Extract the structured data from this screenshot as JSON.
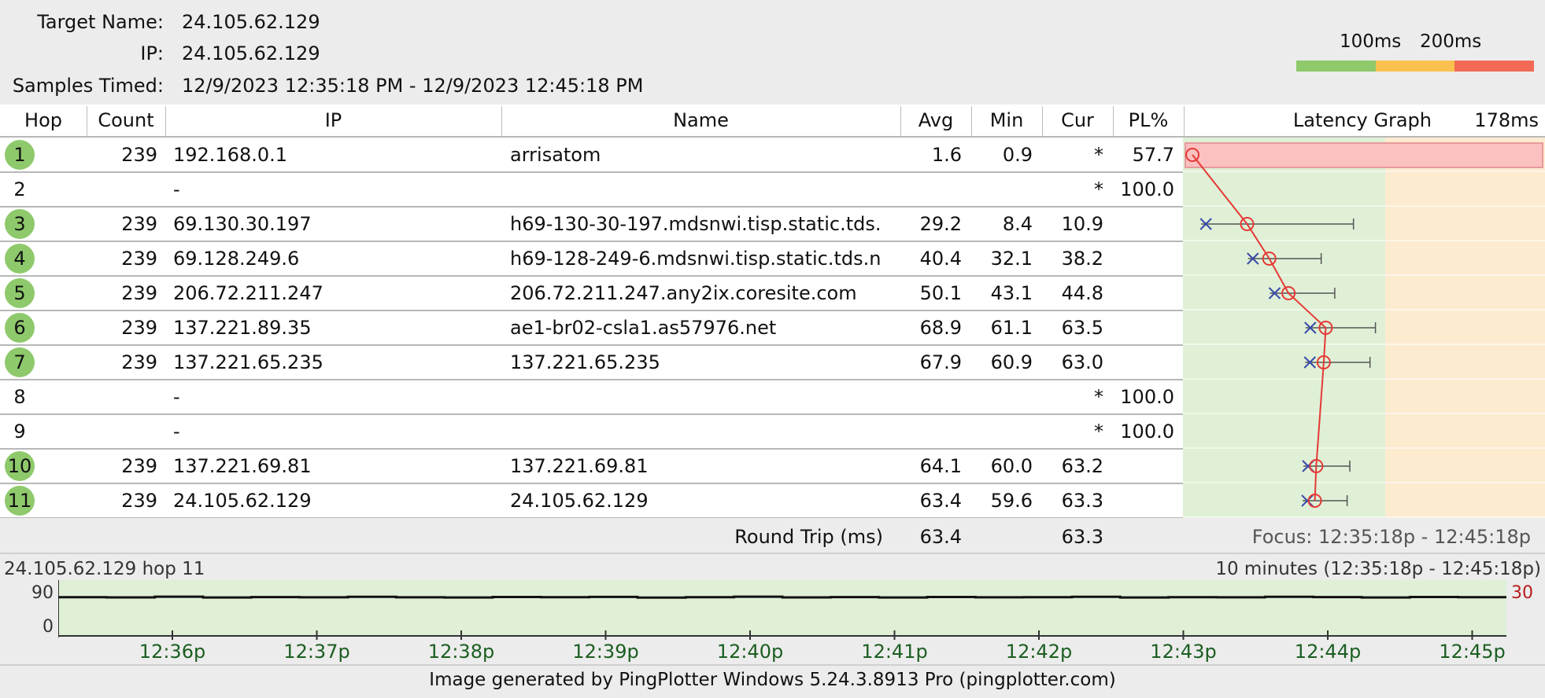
{
  "header": {
    "target_name_label": "Target Name:",
    "target_name": "24.105.62.129",
    "ip_label": "IP:",
    "ip": "24.105.62.129",
    "samples_label": "Samples Timed:",
    "samples_value": "12/9/2023 12:35:18 PM - 12/9/2023 12:45:18 PM"
  },
  "legend": {
    "label_100": "100ms",
    "label_200": "200ms",
    "colors": [
      "#8ec96b",
      "#f9c24f",
      "#f26a55"
    ]
  },
  "table": {
    "columns": {
      "hop": "Hop",
      "count": "Count",
      "ip": "IP",
      "name": "Name",
      "avg": "Avg",
      "min": "Min",
      "cur": "Cur",
      "pl": "PL%",
      "graph": "Latency Graph",
      "graph_max": "178ms"
    },
    "rows": [
      {
        "hop": "1",
        "ok": true,
        "count": "239",
        "ip": "192.168.0.1",
        "name": "arrisatom",
        "avg": "1.6",
        "min": "0.9",
        "cur": "*",
        "pl": "57.7"
      },
      {
        "hop": "2",
        "ok": false,
        "count": "",
        "ip": "-",
        "name": "",
        "avg": "",
        "min": "",
        "cur": "*",
        "pl": "100.0"
      },
      {
        "hop": "3",
        "ok": true,
        "count": "239",
        "ip": "69.130.30.197",
        "name": "h69-130-30-197.mdsnwi.tisp.static.tds.",
        "avg": "29.2",
        "min": "8.4",
        "cur": "10.9",
        "pl": ""
      },
      {
        "hop": "4",
        "ok": true,
        "count": "239",
        "ip": "69.128.249.6",
        "name": "h69-128-249-6.mdsnwi.tisp.static.tds.n",
        "avg": "40.4",
        "min": "32.1",
        "cur": "38.2",
        "pl": ""
      },
      {
        "hop": "5",
        "ok": true,
        "count": "239",
        "ip": "206.72.211.247",
        "name": "206.72.211.247.any2ix.coresite.com",
        "avg": "50.1",
        "min": "43.1",
        "cur": "44.8",
        "pl": ""
      },
      {
        "hop": "6",
        "ok": true,
        "count": "239",
        "ip": "137.221.89.35",
        "name": "ae1-br02-csla1.as57976.net",
        "avg": "68.9",
        "min": "61.1",
        "cur": "63.5",
        "pl": ""
      },
      {
        "hop": "7",
        "ok": true,
        "count": "239",
        "ip": "137.221.65.235",
        "name": "137.221.65.235",
        "avg": "67.9",
        "min": "60.9",
        "cur": "63.0",
        "pl": ""
      },
      {
        "hop": "8",
        "ok": false,
        "count": "",
        "ip": "-",
        "name": "",
        "avg": "",
        "min": "",
        "cur": "*",
        "pl": "100.0"
      },
      {
        "hop": "9",
        "ok": false,
        "count": "",
        "ip": "-",
        "name": "",
        "avg": "",
        "min": "",
        "cur": "*",
        "pl": "100.0"
      },
      {
        "hop": "10",
        "ok": true,
        "count": "239",
        "ip": "137.221.69.81",
        "name": "137.221.69.81",
        "avg": "64.1",
        "min": "60.0",
        "cur": "63.2",
        "pl": ""
      },
      {
        "hop": "11",
        "ok": true,
        "count": "239",
        "ip": "24.105.62.129",
        "name": "24.105.62.129",
        "avg": "63.4",
        "min": "59.6",
        "cur": "63.3",
        "pl": ""
      }
    ],
    "round_trip_label": "Round Trip (ms)",
    "round_trip_avg": "63.4",
    "round_trip_cur": "63.3",
    "focus_text": "Focus: 12:35:18p - 12:45:18p"
  },
  "chart_data": {
    "type": "line",
    "title": "24.105.62.129 hop 11",
    "subtitle": "10 minutes (12:35:18p - 12:45:18p)",
    "ytick_top": "90",
    "ytick_bottom": "0",
    "right_label": "30",
    "xlabels": [
      "12:36p",
      "12:37p",
      "12:38p",
      "12:39p",
      "12:40p",
      "12:41p",
      "12:42p",
      "12:43p",
      "12:44p",
      "12:45p"
    ],
    "ylim": [
      0,
      90
    ],
    "series": [
      {
        "values": [
          63.3,
          63.0,
          64.1,
          62.8,
          63.5,
          63.2,
          64.0,
          63.1,
          62.9,
          63.6,
          63.4,
          63.8,
          62.7,
          63.3,
          64.2,
          63.0,
          63.5,
          62.9,
          63.7,
          63.2,
          63.4,
          63.9,
          62.8,
          63.3,
          63.1,
          64.0,
          63.5,
          62.9,
          63.6,
          63.3
        ]
      }
    ]
  },
  "footer": {
    "text": "Image generated by PingPlotter Windows 5.24.3.8913 Pro (pingplotter.com)"
  }
}
